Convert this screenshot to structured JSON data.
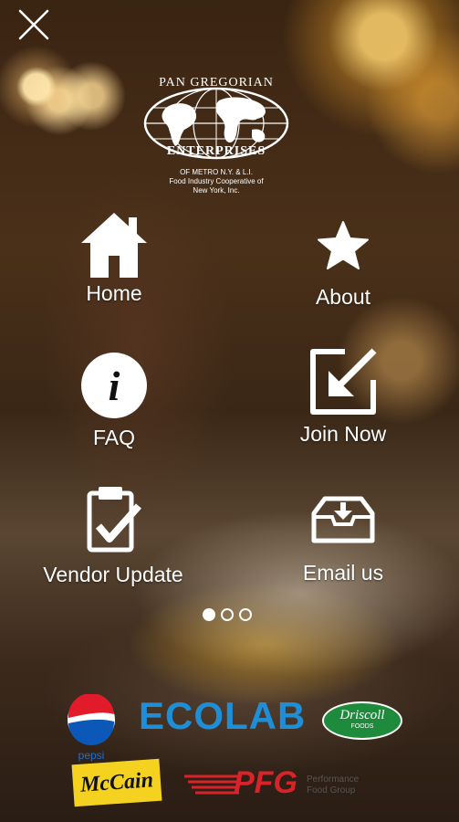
{
  "logo": {
    "line1": "PAN GREGORIAN",
    "line2": "ENTERPRISES",
    "line3": "OF METRO N.Y. & L.I.",
    "line4": "Food Industry Cooperative of",
    "line5": "New York, Inc."
  },
  "menu": {
    "home": "Home",
    "about": "About",
    "faq": "FAQ",
    "join": "Join Now",
    "vendor": "Vendor Update",
    "email": "Email us"
  },
  "pager": {
    "pages": 3,
    "active_index": 0
  },
  "sponsors": {
    "pepsi": "pepsi",
    "ecolab": "ECOLAB",
    "driscoll": "Driscoll",
    "driscoll_sub": "FOODS",
    "mccain": "McCain",
    "pfg": "PFG",
    "pfg_line1": "Performance",
    "pfg_line2": "Food Group"
  },
  "colors": {
    "ecolab_blue": "#1e8fd6",
    "pfg_red": "#d8232a",
    "driscoll_green": "#1e8a3c",
    "mccain_yellow": "#f4d21f"
  }
}
